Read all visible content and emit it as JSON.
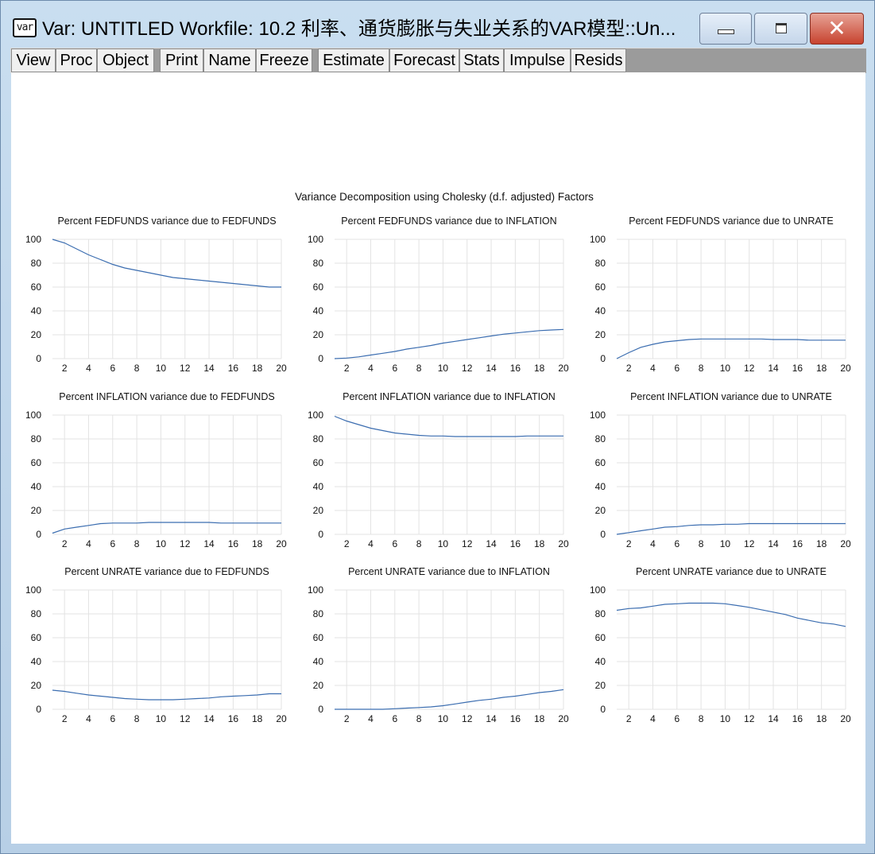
{
  "window": {
    "title": "Var: UNTITLED   Workfile: 10.2 利率、通货膨胀与失业关系的VAR模型::Un...",
    "icon_text": "var",
    "icon": "var-object-icon",
    "controls": {
      "minimize": "minimize-icon",
      "maximize": "maximize-icon",
      "close": "close-icon"
    }
  },
  "toolbar": {
    "buttons": [
      "View",
      "Proc",
      "Object",
      "Print",
      "Name",
      "Freeze",
      "Estimate",
      "Forecast",
      "Stats",
      "Impulse",
      "Resids"
    ]
  },
  "figure": {
    "title": "Variance Decomposition using Cholesky (d.f. adjusted) Factors",
    "line_color": "#3b6db0",
    "grid_color": "#e3e3e3"
  },
  "chart_data": [
    {
      "type": "line",
      "title": "Percent FEDFUNDS variance due to FEDFUNDS",
      "x": [
        1,
        2,
        3,
        4,
        5,
        6,
        7,
        8,
        9,
        10,
        11,
        12,
        13,
        14,
        15,
        16,
        17,
        18,
        19,
        20
      ],
      "values": [
        100,
        97,
        92,
        87,
        83,
        79,
        76,
        74,
        72,
        70,
        68,
        67,
        66,
        65,
        64,
        63,
        62,
        61,
        60,
        60
      ],
      "ylim": [
        0,
        100
      ],
      "yticks": [
        0,
        20,
        40,
        60,
        80,
        100
      ],
      "xticks": [
        2,
        4,
        6,
        8,
        10,
        12,
        14,
        16,
        18,
        20
      ],
      "grid": true
    },
    {
      "type": "line",
      "title": "Percent FEDFUNDS variance due to INFLATION",
      "x": [
        1,
        2,
        3,
        4,
        5,
        6,
        7,
        8,
        9,
        10,
        11,
        12,
        13,
        14,
        15,
        16,
        17,
        18,
        19,
        20
      ],
      "values": [
        0,
        0.5,
        1.5,
        3,
        4.5,
        6,
        8,
        9.5,
        11,
        13,
        14.5,
        16,
        17.5,
        19,
        20.5,
        21.5,
        22.5,
        23.5,
        24,
        24.5
      ],
      "ylim": [
        0,
        100
      ],
      "yticks": [
        0,
        20,
        40,
        60,
        80,
        100
      ],
      "xticks": [
        2,
        4,
        6,
        8,
        10,
        12,
        14,
        16,
        18,
        20
      ],
      "grid": true
    },
    {
      "type": "line",
      "title": "Percent FEDFUNDS variance due to UNRATE",
      "x": [
        1,
        2,
        3,
        4,
        5,
        6,
        7,
        8,
        9,
        10,
        11,
        12,
        13,
        14,
        15,
        16,
        17,
        18,
        19,
        20
      ],
      "values": [
        0,
        5,
        9.5,
        12,
        14,
        15,
        16,
        16.5,
        16.5,
        16.5,
        16.5,
        16.5,
        16.5,
        16,
        16,
        16,
        15.5,
        15.5,
        15.5,
        15.5
      ],
      "ylim": [
        0,
        100
      ],
      "yticks": [
        0,
        20,
        40,
        60,
        80,
        100
      ],
      "xticks": [
        2,
        4,
        6,
        8,
        10,
        12,
        14,
        16,
        18,
        20
      ],
      "grid": true
    },
    {
      "type": "line",
      "title": "Percent INFLATION variance due to FEDFUNDS",
      "x": [
        1,
        2,
        3,
        4,
        5,
        6,
        7,
        8,
        9,
        10,
        11,
        12,
        13,
        14,
        15,
        16,
        17,
        18,
        19,
        20
      ],
      "values": [
        1,
        4.5,
        6,
        7.5,
        9,
        9.5,
        9.5,
        9.5,
        10,
        10,
        10,
        10,
        10,
        10,
        9.5,
        9.5,
        9.5,
        9.5,
        9.5,
        9.5
      ],
      "ylim": [
        0,
        100
      ],
      "yticks": [
        0,
        20,
        40,
        60,
        80,
        100
      ],
      "xticks": [
        2,
        4,
        6,
        8,
        10,
        12,
        14,
        16,
        18,
        20
      ],
      "grid": true
    },
    {
      "type": "line",
      "title": "Percent INFLATION variance due to INFLATION",
      "x": [
        1,
        2,
        3,
        4,
        5,
        6,
        7,
        8,
        9,
        10,
        11,
        12,
        13,
        14,
        15,
        16,
        17,
        18,
        19,
        20
      ],
      "values": [
        99,
        95,
        92,
        89,
        87,
        85,
        84,
        83,
        82.5,
        82.5,
        82,
        82,
        82,
        82,
        82,
        82,
        82.5,
        82.5,
        82.5,
        82.5
      ],
      "ylim": [
        0,
        100
      ],
      "yticks": [
        0,
        20,
        40,
        60,
        80,
        100
      ],
      "xticks": [
        2,
        4,
        6,
        8,
        10,
        12,
        14,
        16,
        18,
        20
      ],
      "grid": true
    },
    {
      "type": "line",
      "title": "Percent INFLATION variance due to UNRATE",
      "x": [
        1,
        2,
        3,
        4,
        5,
        6,
        7,
        8,
        9,
        10,
        11,
        12,
        13,
        14,
        15,
        16,
        17,
        18,
        19,
        20
      ],
      "values": [
        0,
        1.5,
        3,
        4.5,
        6,
        6.5,
        7.5,
        8,
        8,
        8.5,
        8.5,
        9,
        9,
        9,
        9,
        9,
        9,
        9,
        9,
        9
      ],
      "ylim": [
        0,
        100
      ],
      "yticks": [
        0,
        20,
        40,
        60,
        80,
        100
      ],
      "xticks": [
        2,
        4,
        6,
        8,
        10,
        12,
        14,
        16,
        18,
        20
      ],
      "grid": true
    },
    {
      "type": "line",
      "title": "Percent UNRATE variance due to FEDFUNDS",
      "x": [
        1,
        2,
        3,
        4,
        5,
        6,
        7,
        8,
        9,
        10,
        11,
        12,
        13,
        14,
        15,
        16,
        17,
        18,
        19,
        20
      ],
      "values": [
        16,
        15,
        13.5,
        12,
        11,
        10,
        9,
        8.5,
        8,
        8,
        8,
        8.5,
        9,
        9.5,
        10.5,
        11,
        11.5,
        12,
        13,
        13
      ],
      "ylim": [
        0,
        100
      ],
      "yticks": [
        0,
        20,
        40,
        60,
        80,
        100
      ],
      "xticks": [
        2,
        4,
        6,
        8,
        10,
        12,
        14,
        16,
        18,
        20
      ],
      "grid": true
    },
    {
      "type": "line",
      "title": "Percent UNRATE variance due to INFLATION",
      "x": [
        1,
        2,
        3,
        4,
        5,
        6,
        7,
        8,
        9,
        10,
        11,
        12,
        13,
        14,
        15,
        16,
        17,
        18,
        19,
        20
      ],
      "values": [
        0,
        0,
        0,
        0,
        0,
        0.5,
        1,
        1.5,
        2,
        3,
        4.5,
        6,
        7.5,
        8.5,
        10,
        11,
        12.5,
        14,
        15,
        16.5
      ],
      "ylim": [
        0,
        100
      ],
      "yticks": [
        0,
        20,
        40,
        60,
        80,
        100
      ],
      "xticks": [
        2,
        4,
        6,
        8,
        10,
        12,
        14,
        16,
        18,
        20
      ],
      "grid": true
    },
    {
      "type": "line",
      "title": "Percent UNRATE variance due to UNRATE",
      "x": [
        1,
        2,
        3,
        4,
        5,
        6,
        7,
        8,
        9,
        10,
        11,
        12,
        13,
        14,
        15,
        16,
        17,
        18,
        19,
        20
      ],
      "values": [
        83,
        84.5,
        85,
        86.5,
        88,
        88.5,
        89,
        89,
        89,
        88.5,
        87,
        85.5,
        83.5,
        81.5,
        79.5,
        76.5,
        74.5,
        72.5,
        71.5,
        69.5
      ],
      "ylim": [
        0,
        100
      ],
      "yticks": [
        0,
        20,
        40,
        60,
        80,
        100
      ],
      "xticks": [
        2,
        4,
        6,
        8,
        10,
        12,
        14,
        16,
        18,
        20
      ],
      "grid": true
    }
  ]
}
